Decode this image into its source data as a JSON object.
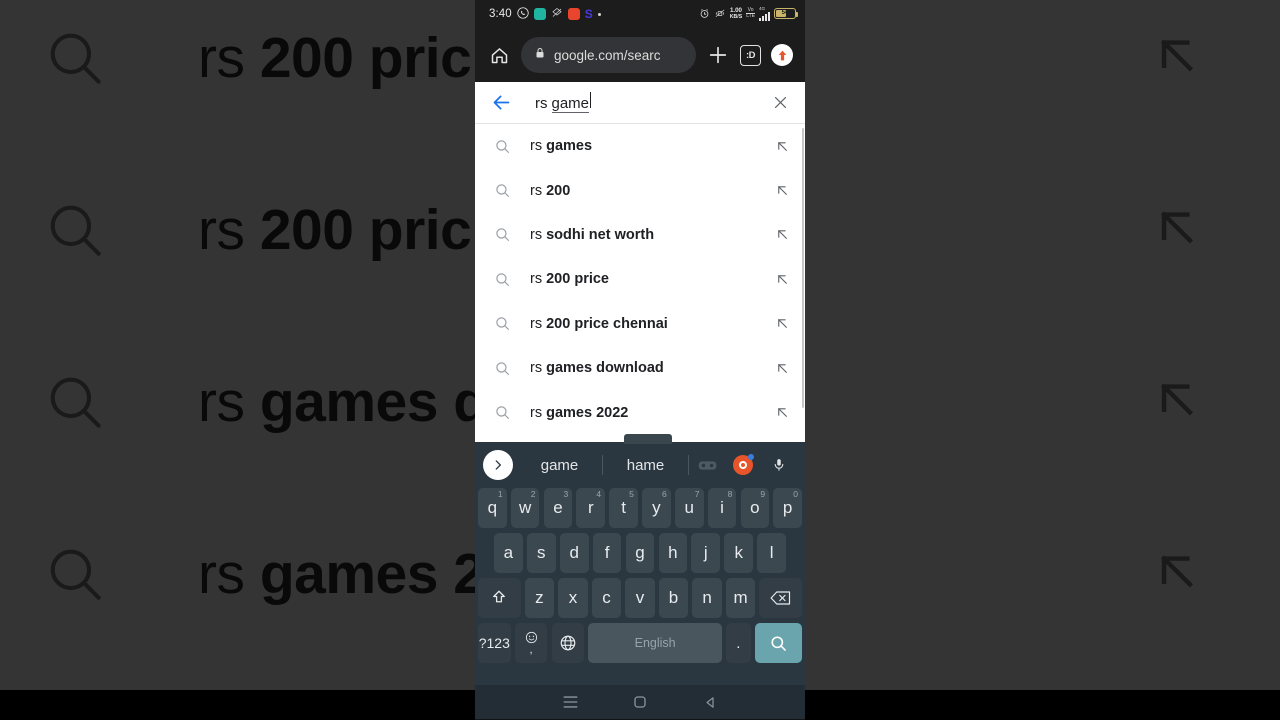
{
  "background": {
    "note": "dimmed magnified copy of the suggestion list behind the phone viewport",
    "rows": [
      {
        "prefix": "rs ",
        "bold": "200 pric"
      },
      {
        "prefix": "rs ",
        "bold": "200 pric"
      },
      {
        "prefix": "rs ",
        "bold": "games d"
      },
      {
        "prefix": "rs ",
        "bold": "games 2"
      }
    ]
  },
  "status_bar": {
    "time": "3:40",
    "app_icons": [
      "whatsapp-icon",
      "teal-app-icon",
      "crossed-eye-icon",
      "red-app-icon",
      "s-app-icon",
      "dot-icon"
    ],
    "alarm_icon": "alarm-icon",
    "vibrate_icon": "vibrate-off-icon",
    "network_speed": "1.00",
    "network_speed_unit": "KB/S",
    "volte_label": "Vo LTE",
    "network_type": "4G",
    "signal_icon": "signal-bars-icon",
    "battery_percent": "54"
  },
  "toolbar": {
    "home_icon": "home-icon",
    "lock_icon": "lock-icon",
    "url": "google.com/searc",
    "new_tab_icon": "plus-icon",
    "tab_count": ":D",
    "profile_icon": "profile-avatar-icon"
  },
  "search_sheet": {
    "back_icon": "back-arrow-icon",
    "query_prefix": "rs ",
    "query_composing": "game",
    "clear_icon": "close-icon",
    "suggestions": [
      {
        "prefix": "rs ",
        "bold": "games",
        "search_icon": "search-icon",
        "fill_icon": "arrow-up-left-icon"
      },
      {
        "prefix": "rs ",
        "bold": "200",
        "search_icon": "search-icon",
        "fill_icon": "arrow-up-left-icon"
      },
      {
        "prefix": "rs ",
        "bold": "sodhi net worth",
        "search_icon": "search-icon",
        "fill_icon": "arrow-up-left-icon"
      },
      {
        "prefix": "rs ",
        "bold": "200 price",
        "search_icon": "search-icon",
        "fill_icon": "arrow-up-left-icon"
      },
      {
        "prefix": "rs ",
        "bold": "200 price chennai",
        "search_icon": "search-icon",
        "fill_icon": "arrow-up-left-icon"
      },
      {
        "prefix": "rs ",
        "bold": "games download",
        "search_icon": "search-icon",
        "fill_icon": "arrow-up-left-icon"
      },
      {
        "prefix": "rs ",
        "bold": "games 2022",
        "search_icon": "search-icon",
        "fill_icon": "arrow-up-left-icon"
      }
    ]
  },
  "keyboard": {
    "suggestion_strip": {
      "expand_icon": "chevron-right-icon",
      "word_1": "game",
      "word_2": "hame",
      "gamepad_icon": "gamepad-icon",
      "target_icon": "target-icon",
      "mic_icon": "microphone-icon"
    },
    "row1": [
      {
        "key": "q",
        "sup": "1"
      },
      {
        "key": "w",
        "sup": "2"
      },
      {
        "key": "e",
        "sup": "3"
      },
      {
        "key": "r",
        "sup": "4"
      },
      {
        "key": "t",
        "sup": "5"
      },
      {
        "key": "y",
        "sup": "6"
      },
      {
        "key": "u",
        "sup": "7"
      },
      {
        "key": "i",
        "sup": "8"
      },
      {
        "key": "o",
        "sup": "9"
      },
      {
        "key": "p",
        "sup": "0"
      }
    ],
    "row2": [
      "a",
      "s",
      "d",
      "f",
      "g",
      "h",
      "j",
      "k",
      "l"
    ],
    "row3": {
      "shift_icon": "shift-icon",
      "letters": [
        "z",
        "x",
        "c",
        "v",
        "b",
        "n",
        "m"
      ],
      "backspace_icon": "backspace-icon"
    },
    "row4": {
      "symbols_label": "?123",
      "emoji_icon": "emoji-comma-icon",
      "globe_icon": "language-globe-icon",
      "space_label": "English",
      "period_label": ".",
      "enter_icon": "search-enter-icon"
    }
  },
  "nav_bar": {
    "recents_icon": "recents-menu-icon",
    "home_icon": "home-square-icon",
    "back_icon": "back-triangle-icon"
  },
  "colors": {
    "accent_blue": "#1a73e8",
    "keyboard_bg": "#2b3740",
    "key_bg": "#3c4850",
    "enter_key": "#6aa5ad",
    "sheet_bg": "#ffffff",
    "toolbar_bg": "#1c1c1c",
    "battery": "#c9b46a"
  }
}
